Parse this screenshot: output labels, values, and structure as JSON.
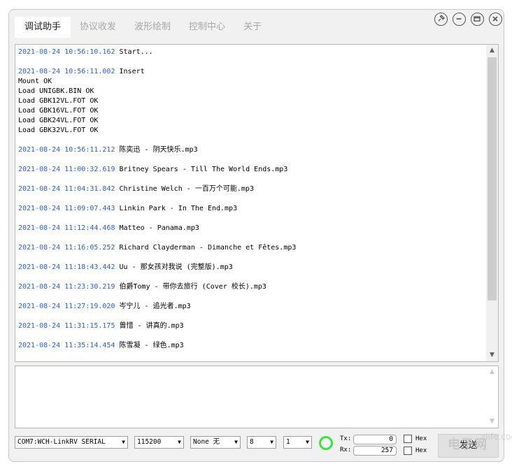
{
  "tabs": [
    {
      "label": "调试助手",
      "active": true
    },
    {
      "label": "协议收发",
      "active": false
    },
    {
      "label": "波形绘制",
      "active": false
    },
    {
      "label": "控制中心",
      "active": false
    },
    {
      "label": "关于",
      "active": false
    }
  ],
  "window_buttons": [
    "pin-icon",
    "minimize-icon",
    "maximize-icon",
    "close-icon"
  ],
  "log": [
    {
      "ts": "2021-08-24 10:56:10.162",
      "lines": [
        "Start..."
      ]
    },
    {
      "ts": "2021-08-24 10:56:11.002",
      "lines": [
        "Insert",
        "Mount OK",
        "Load UNIGBK.BIN OK",
        "Load GBK12VL.FOT OK",
        "Load GBK16VL.FOT OK",
        "Load GBK24VL.FOT OK",
        "Load GBK32VL.FOT OK"
      ]
    },
    {
      "ts": "2021-08-24 10:56:11.212",
      "lines": [
        "陈奕迅 - 阴天快乐.mp3"
      ]
    },
    {
      "ts": "2021-08-24 11:00:32.619",
      "lines": [
        "Britney Spears - Till The World Ends.mp3"
      ]
    },
    {
      "ts": "2021-08-24 11:04:31.842",
      "lines": [
        "Christine Welch - 一百万个可能.mp3"
      ]
    },
    {
      "ts": "2021-08-24 11:09:07.443",
      "lines": [
        "Linkin Park - In The End.mp3"
      ]
    },
    {
      "ts": "2021-08-24 11:12:44.468",
      "lines": [
        "Matteo - Panama.mp3"
      ]
    },
    {
      "ts": "2021-08-24 11:16:05.252",
      "lines": [
        "Richard Clayderman - Dimanche et Fêtes.mp3"
      ]
    },
    {
      "ts": "2021-08-24 11:18:43.442",
      "lines": [
        "Uu - 那女孩对我说 (完整版).mp3"
      ]
    },
    {
      "ts": "2021-08-24 11:23:30.219",
      "lines": [
        "伯爵Tomy - 带你去旅行 (Cover 校长).mp3"
      ]
    },
    {
      "ts": "2021-08-24 11:27:19.020",
      "lines": [
        "岑宁儿 - 追光者.mp3"
      ]
    },
    {
      "ts": "2021-08-24 11:31:15.175",
      "lines": [
        "曾惜 - 讲真的.mp3"
      ]
    },
    {
      "ts": "2021-08-24 11:35:14.454",
      "lines": [
        "陈雪凝 - 绿色.mp3"
      ]
    }
  ],
  "send_input": {
    "value": ""
  },
  "controls": {
    "port": "COM7:WCH-LinkRV SERIAL",
    "baud": "115200",
    "parity": "None 无",
    "databits": "8",
    "stopbits": "1",
    "tx_label": "Tx:",
    "rx_label": "Rx:",
    "tx_count": "0",
    "rx_count": "257",
    "hex_tx_label": "Hex",
    "hex_rx_label": "Hex",
    "send_label": "发送"
  },
  "status_led_color": "#3fe23f",
  "watermark": {
    "text": "电子网",
    "sub": "zlife.com"
  }
}
